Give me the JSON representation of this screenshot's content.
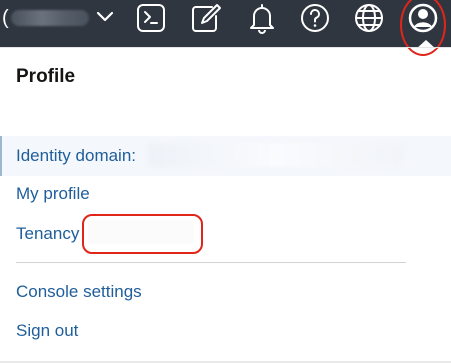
{
  "topbar": {
    "region_prefix": "(",
    "icons": {
      "region": "chevron-down-icon",
      "cloud_shell": "terminal-icon",
      "code_editor": "edit-icon",
      "notifications": "bell-icon",
      "help": "help-icon",
      "language": "globe-icon",
      "profile": "user-icon"
    },
    "background_color": "#2f3640"
  },
  "profile_menu": {
    "title": "Profile",
    "items": [
      {
        "label": "Identity domain:"
      },
      {
        "label": "My profile"
      },
      {
        "label": "Tenancy"
      },
      {
        "label": "Console settings"
      },
      {
        "label": "Sign out"
      }
    ]
  },
  "colors": {
    "link": "#1f5e9a",
    "highlight": "#e0251b",
    "title": "#161513"
  }
}
